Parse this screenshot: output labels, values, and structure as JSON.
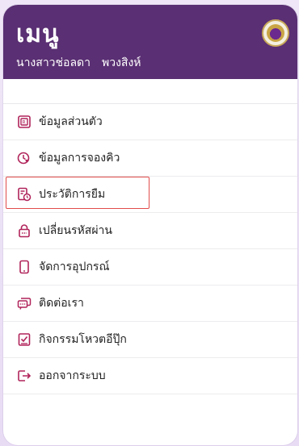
{
  "header": {
    "title": "เมนู",
    "first_name": "นางสาวช่อลดา",
    "last_name": "พวงสิงห์"
  },
  "menu": {
    "items": [
      {
        "label": "ข้อมูลส่วนตัว",
        "icon": "id-card-icon"
      },
      {
        "label": "ข้อมูลการจองคิว",
        "icon": "clock-heart-icon"
      },
      {
        "label": "ประวัติการยืม",
        "icon": "borrow-history-icon"
      },
      {
        "label": "เปลี่ยนรหัสผ่าน",
        "icon": "lock-icon"
      },
      {
        "label": "จัดการอุปกรณ์",
        "icon": "mobile-device-icon"
      },
      {
        "label": "ติดต่อเรา",
        "icon": "chat-bubbles-icon"
      },
      {
        "label": "กิจกรรมโหวตอีปุ๊ก",
        "icon": "vote-checkbox-icon"
      },
      {
        "label": "ออกจากระบบ",
        "icon": "logout-icon"
      }
    ]
  },
  "colors": {
    "header_bg": "#5a2f73",
    "icon_color": "#b0245a",
    "highlight_border": "#e14b4b"
  }
}
